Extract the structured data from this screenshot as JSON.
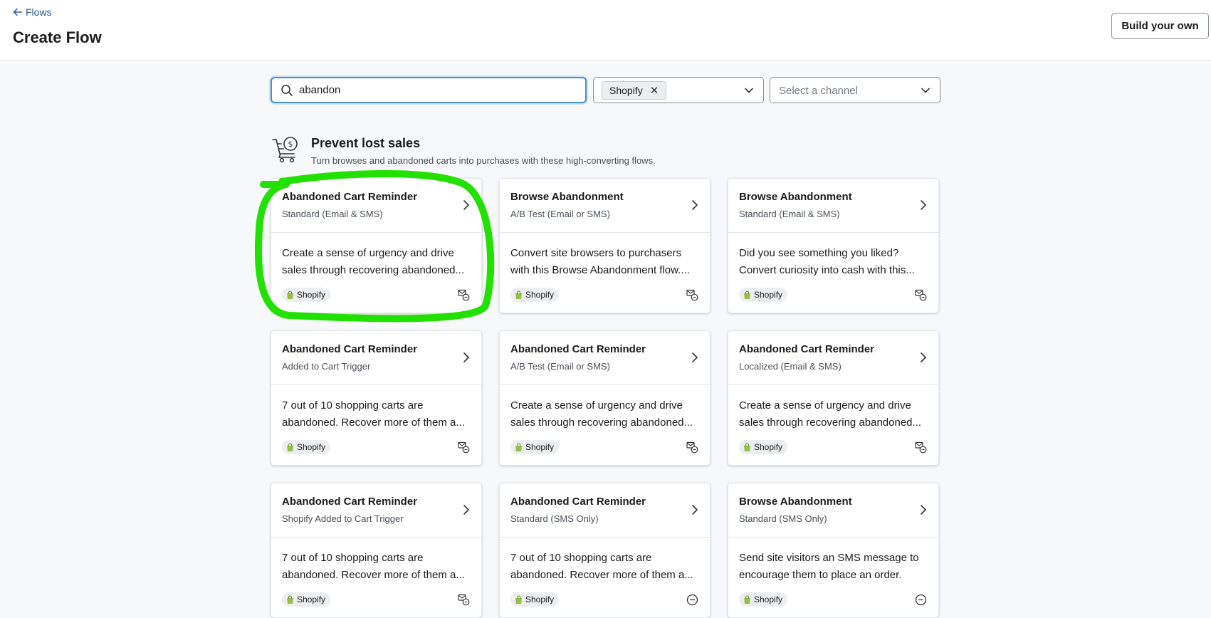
{
  "header": {
    "back_label": "Flows",
    "title": "Create Flow",
    "build_button": "Build your own"
  },
  "filters": {
    "search_value": "abandon",
    "integration_chip": "Shopify",
    "channel_placeholder": "Select a channel"
  },
  "section": {
    "title": "Prevent lost sales",
    "subtitle": "Turn browses and abandoned carts into purchases with these high-converting flows."
  },
  "cards": [
    {
      "title": "Abandoned Cart Reminder",
      "subtitle": "Standard (Email & SMS)",
      "description": "Create a sense of urgency and drive sales through recovering abandoned...",
      "badge": "Shopify",
      "channel_icon": "email-sms-icon"
    },
    {
      "title": "Browse Abandonment",
      "subtitle": "A/B Test (Email or SMS)",
      "description": "Convert site browsers to purchasers with this Browse Abandonment flow....",
      "badge": "Shopify",
      "channel_icon": "email-sms-icon"
    },
    {
      "title": "Browse Abandonment",
      "subtitle": "Standard (Email & SMS)",
      "description": "Did you see something you liked? Convert curiosity into cash with this...",
      "badge": "Shopify",
      "channel_icon": "email-sms-icon"
    },
    {
      "title": "Abandoned Cart Reminder",
      "subtitle": "Added to Cart Trigger",
      "description": "7 out of 10 shopping carts are abandoned. Recover more of them a...",
      "badge": "Shopify",
      "channel_icon": "email-sms-icon"
    },
    {
      "title": "Abandoned Cart Reminder",
      "subtitle": "A/B Test (Email or SMS)",
      "description": "Create a sense of urgency and drive sales through recovering abandoned...",
      "badge": "Shopify",
      "channel_icon": "email-sms-icon"
    },
    {
      "title": "Abandoned Cart Reminder",
      "subtitle": "Localized (Email & SMS)",
      "description": "Create a sense of urgency and drive sales through recovering abandoned...",
      "badge": "Shopify",
      "channel_icon": "email-sms-icon"
    },
    {
      "title": "Abandoned Cart Reminder",
      "subtitle": "Shopify Added to Cart Trigger",
      "description": "7 out of 10 shopping carts are abandoned. Recover more of them a...",
      "badge": "Shopify",
      "channel_icon": "email-sms-icon"
    },
    {
      "title": "Abandoned Cart Reminder",
      "subtitle": "Standard (SMS Only)",
      "description": "7 out of 10 shopping carts are abandoned. Recover more of them a...",
      "badge": "Shopify",
      "channel_icon": "sms-icon"
    },
    {
      "title": "Browse Abandonment",
      "subtitle": "Standard (SMS Only)",
      "description": "Send site visitors an SMS message to encourage them to place an order.",
      "badge": "Shopify",
      "channel_icon": "sms-icon"
    }
  ],
  "colors": {
    "accent_link": "#2b5c8a",
    "search_focus": "#4a8fd1",
    "annotation_highlight": "#22e000",
    "shopify_green": "#5e8e3e"
  }
}
